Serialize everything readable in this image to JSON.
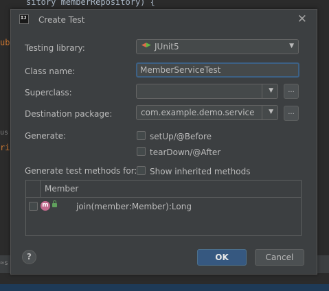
{
  "background": {
    "code_top": "sitory memberRepository) {",
    "code_pub": "ubl",
    "code_us": "us",
    "code_ri": "ri",
    "status_hint": "≈s"
  },
  "dialog": {
    "app_icon": "IJ",
    "title": "Create Test",
    "close_glyph": "✕"
  },
  "form": {
    "testing_library_label": "Testing library:",
    "testing_library_value": "JUnit5",
    "class_name_label": "Class name:",
    "class_name_value": "MemberServiceTest",
    "superclass_label": "Superclass:",
    "superclass_value": "",
    "destination_label": "Destination package:",
    "destination_value": "com.example.demo.service",
    "browse_label": "...",
    "generate_label": "Generate:",
    "setup_label": "setUp/@Before",
    "teardown_label": "tearDown/@After",
    "methods_label": "Generate test methods for:",
    "show_inherited_label": "Show inherited methods"
  },
  "table": {
    "header": "Member",
    "rows": [
      {
        "icon": "m",
        "method": "join(member:Member):Long",
        "checked": false
      }
    ]
  },
  "buttons": {
    "help": "?",
    "ok": "OK",
    "cancel": "Cancel"
  },
  "colors": {
    "accent": "#365880",
    "dialog_bg": "#3c3f41",
    "method_icon": "#c26a8e"
  }
}
